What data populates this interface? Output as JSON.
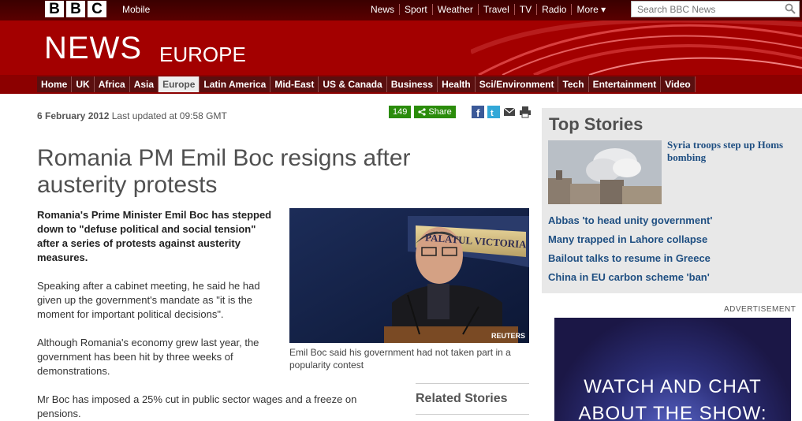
{
  "topbar": {
    "logo_letters": [
      "B",
      "B",
      "C"
    ],
    "mobile": "Mobile",
    "nav": [
      "News",
      "Sport",
      "Weather",
      "Travel",
      "TV",
      "Radio",
      "More"
    ],
    "search_placeholder": "Search BBC News"
  },
  "banner": {
    "news": "NEWS",
    "section": "EUROPE"
  },
  "sections": {
    "tabs": [
      "Home",
      "UK",
      "Africa",
      "Asia",
      "Europe",
      "Latin America",
      "Mid-East",
      "US & Canada",
      "Business",
      "Health",
      "Sci/Environment",
      "Tech",
      "Entertainment",
      "Video"
    ],
    "active": "Europe"
  },
  "article": {
    "date": "6 February 2012",
    "updated": "Last updated at 09:58 GMT",
    "share_count": "149",
    "share_label": "Share",
    "headline": "Romania PM Emil Boc resigns after austerity protests",
    "intro": "Romania's Prime Minister Emil Boc has stepped down to \"defuse political and social tension\" after a series of protests against austerity measures.",
    "para1": "Speaking after a cabinet meeting, he said he had given up the government's mandate as \"it is the moment for important political decisions\".",
    "para2": "Although Romania's economy grew last year, the government has been hit by three weeks of demonstrations.",
    "para3": "Mr Boc has imposed a 25% cut in public sector wages and a freeze on pensions.",
    "photo_sign": "PALATUL VICTORIA",
    "photo_credit": "REUTERS",
    "caption": "Emil Boc said his government had not taken part in a popularity contest",
    "related_title": "Related Stories"
  },
  "top_stories": {
    "title": "Top Stories",
    "lead": "Syria troops step up Homs bombing",
    "items": [
      "Abbas 'to head unity government'",
      "Many trapped in Lahore collapse",
      "Bailout talks to resume in Greece",
      "China in EU carbon scheme 'ban'"
    ]
  },
  "advert": {
    "label": "ADVERTISEMENT",
    "line1": "WATCH AND CHAT",
    "line2": "ABOUT THE SHOW:"
  },
  "colors": {
    "brand_red": "#a30000",
    "link_blue": "#1f4f82",
    "share_green": "#2b8c0b"
  }
}
